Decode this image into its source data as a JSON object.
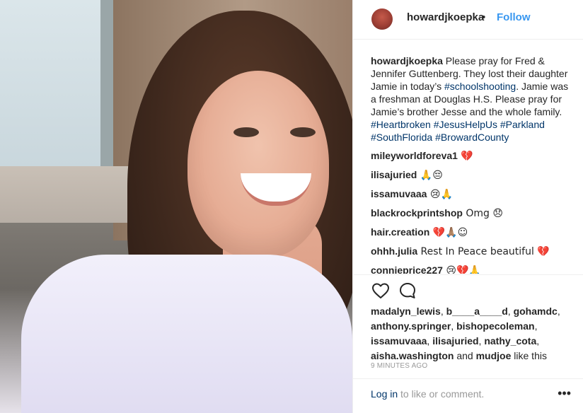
{
  "header": {
    "username": "howardjkoepka",
    "dot": "•",
    "follow_label": "Follow"
  },
  "caption": {
    "username": "howardjkoepka",
    "text_before_tag": " Please pray for Fred & Jennifer Guttenberg. They lost their daughter Jamie in today’s ",
    "tag1": "#schoolshooting",
    "text_after_tag1": ". Jamie was a freshman at Douglas H.S. Please pray for Jamie’s brother Jesse and the whole family. ",
    "tag2": "#Heartbroken",
    "space1": " ",
    "tag3": "#JesusHelpUs",
    "space2": " ",
    "tag4": "#Parkland",
    "space3": " ",
    "tag5": "#SouthFlorida",
    "space4": " ",
    "tag6": "#BrowardCounty"
  },
  "comments": [
    {
      "username": "mileyworldforeva1",
      "text": " 💔"
    },
    {
      "username": "ilisajuried",
      "text": " 🙏😔"
    },
    {
      "username": "issamuvaaa",
      "text": " 😢🙏"
    },
    {
      "username": "blackrockprintshop",
      "text": " Omg 😞"
    },
    {
      "username": "hair.creation",
      "text": " 💔🙏🏽☺"
    },
    {
      "username": "ohhh.julia",
      "text": " Rest In Peace beautiful 💔"
    },
    {
      "username": "connieprice227",
      "text": " 😢💔🙏"
    }
  ],
  "actions": {
    "like_icon": "heart-icon",
    "comment_icon": "speech-bubble-icon"
  },
  "likes": {
    "line1_a": "madalyn_lewis",
    "line1_b": ", ",
    "line1_c": "b____a____d",
    "line1_d": ", ",
    "line1_e": "gohamdc",
    "line1_f": ",",
    "line2_a": "anthony.springer",
    "line2_b": ", ",
    "line2_c": "bishopecoleman",
    "line2_d": ",",
    "line3_a": "issamuvaaa",
    "line3_b": ", ",
    "line3_c": "ilisajuried",
    "line3_d": ", ",
    "line3_e": "nathy_cota",
    "line3_f": ",",
    "line4_a": "aisha.washington",
    "line4_b": " and ",
    "line4_c": "mudjoe",
    "line4_d": " like this"
  },
  "timestamp": "9 MINUTES AGO",
  "footer": {
    "login_link": "Log in",
    "login_rest": " to like or comment.",
    "more_icon": "•••"
  },
  "colors": {
    "link_blue": "#3897f0",
    "hashtag": "#003569",
    "muted": "#999999"
  }
}
